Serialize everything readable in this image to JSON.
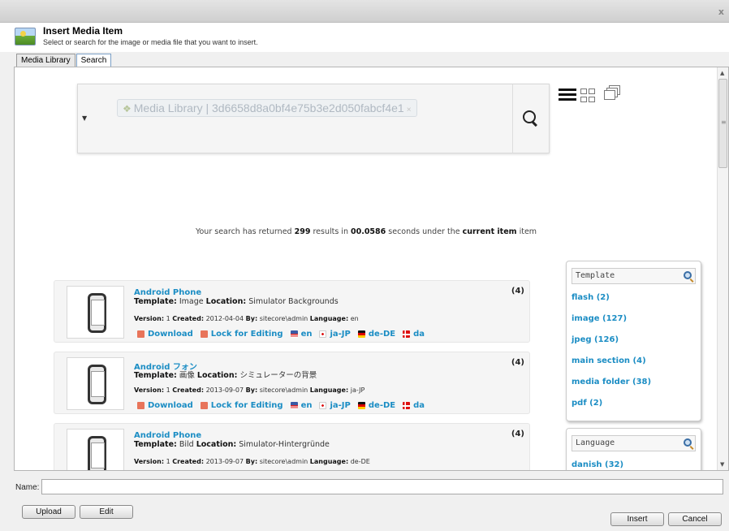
{
  "dialog": {
    "title": "Insert Media Item",
    "subtitle": "Select or search for the image or media file that you want to insert.",
    "close_glyph": "x"
  },
  "tabs": [
    {
      "label": "Media Library",
      "active": false
    },
    {
      "label": "Search",
      "active": true
    }
  ],
  "search": {
    "token_icon": "media-library-icon",
    "token_text": "Media Library | 3d6658d8a0bf4e75b3e2d050fabcf4e1",
    "token_remove": "×",
    "dropdown_glyph": "▼",
    "search_icon": "magnifier-icon"
  },
  "view_modes": [
    "list-view-icon",
    "grid-view-icon",
    "gallery-view-icon"
  ],
  "summary": {
    "pre": "Your search has returned ",
    "count": "299",
    "mid1": " results in ",
    "time": "00.0586",
    "mid2": " seconds under the ",
    "scope": "current item",
    "post": " item"
  },
  "results": [
    {
      "title": "Android Phone",
      "template_label": "Template:",
      "template": "Image",
      "location_label": "Location:",
      "location": "Simulator Backgrounds",
      "version_label": "Version:",
      "version": "1",
      "created_label": "Created:",
      "created": "2012-04-04",
      "by_label": "By:",
      "by": "sitecore\\admin",
      "language_label": "Language:",
      "language": "en",
      "count": "(4)",
      "actions": {
        "download": "Download",
        "lock": "Lock for Editing"
      },
      "languages": [
        "en",
        "ja-JP",
        "de-DE",
        "da"
      ]
    },
    {
      "title": "Android フォン",
      "template_label": "Template:",
      "template": "画像",
      "location_label": "Location:",
      "location": "シミュレーターの背景",
      "version_label": "Version:",
      "version": "1",
      "created_label": "Created:",
      "created": "2013-09-07",
      "by_label": "By:",
      "by": "sitecore\\admin",
      "language_label": "Language:",
      "language": "ja-JP",
      "count": "(4)",
      "actions": {
        "download": "Download",
        "lock": "Lock for Editing"
      },
      "languages": [
        "en",
        "ja-JP",
        "de-DE",
        "da"
      ]
    },
    {
      "title": "Android Phone",
      "template_label": "Template:",
      "template": "Bild",
      "location_label": "Location:",
      "location": "Simulator-Hintergründe",
      "version_label": "Version:",
      "version": "1",
      "created_label": "Created:",
      "created": "2013-09-07",
      "by_label": "By:",
      "by": "sitecore\\admin",
      "language_label": "Language:",
      "language": "de-DE",
      "count": "(4)"
    }
  ],
  "facets": {
    "template": {
      "title": "Template",
      "items": [
        "flash (2)",
        "image (127)",
        "jpeg (126)",
        "main section (4)",
        "media folder (38)",
        "pdf (2)"
      ]
    },
    "language": {
      "title": "Language",
      "items": [
        "danish (32)"
      ]
    }
  },
  "footer": {
    "name_label": "Name:",
    "name_value": "",
    "upload": "Upload",
    "edit": "Edit",
    "insert": "Insert",
    "cancel": "Cancel"
  }
}
